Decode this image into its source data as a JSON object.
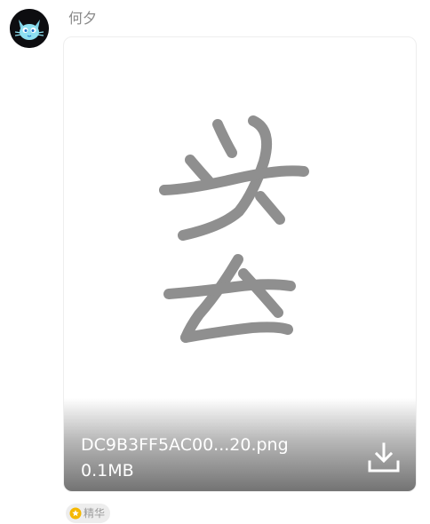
{
  "message": {
    "sender_name": "何夕",
    "avatar_icon": "cat-avatar-icon",
    "file": {
      "name": "DC9B3FF5AC00...20.png",
      "size": "0.1MB",
      "download_icon": "download-icon"
    },
    "badge": {
      "label": "精华",
      "icon": "essence-star-icon",
      "icon_color": "#f5b800"
    }
  },
  "colors": {
    "background": "#ffffff",
    "name_text": "#8a8a8a",
    "stroke_gray": "#8f8f8f",
    "overlay_text": "#ffffff"
  }
}
